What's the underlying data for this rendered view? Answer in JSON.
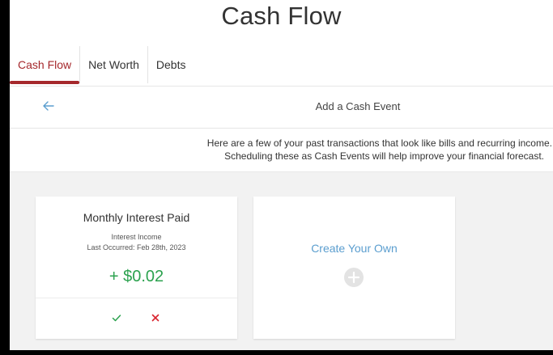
{
  "page_title": "Cash Flow",
  "tabs": [
    {
      "label": "Cash Flow",
      "active": true
    },
    {
      "label": "Net Worth",
      "active": false
    },
    {
      "label": "Debts",
      "active": false
    }
  ],
  "subheader": {
    "back_icon": "arrow-left-icon",
    "title": "Add a Cash Event"
  },
  "intro": {
    "line1": "Here are a few of your past transactions that look like bills and recurring income.",
    "line2": "Scheduling these as Cash Events will help improve your financial forecast."
  },
  "suggestion_card": {
    "title": "Monthly Interest Paid",
    "category": "Interest Income",
    "last_occurred": "Last Occurred: Feb 28th, 2023",
    "amount": "+ $0.02",
    "accept_icon": "check-icon",
    "reject_icon": "close-icon"
  },
  "create_card": {
    "label": "Create Your Own",
    "icon": "plus-circle-icon"
  },
  "colors": {
    "accent_red": "#a5282c",
    "amount_green": "#2ca24f",
    "link_blue": "#5b9ecf"
  }
}
